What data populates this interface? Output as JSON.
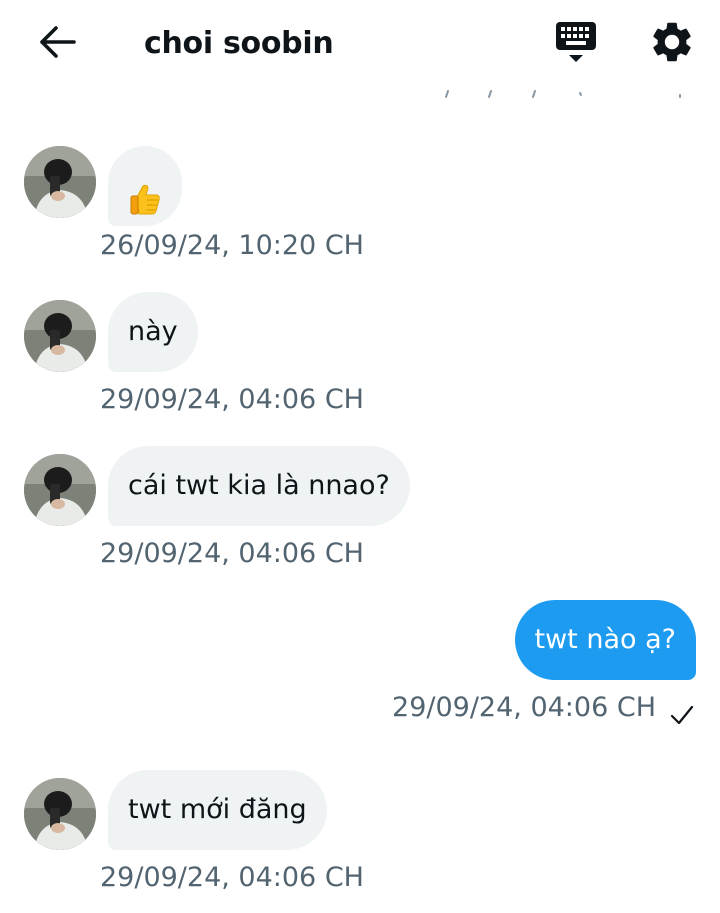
{
  "header": {
    "title": "choi soobin",
    "back_icon": "arrow-left-icon",
    "keyboard_icon": "keyboard-icon",
    "settings_icon": "gear-icon"
  },
  "colors": {
    "incoming_bubble": "#eff3f4",
    "outgoing_bubble": "#1d9bf0",
    "timestamp": "#536471"
  },
  "messages": [
    {
      "direction": "incoming",
      "content": "👍",
      "timestamp": "26/09/24, 10:20 CH"
    },
    {
      "direction": "incoming",
      "content": "này",
      "timestamp": "29/09/24, 04:06 CH"
    },
    {
      "direction": "incoming",
      "content": "cái twt kia là nnao?",
      "timestamp": "29/09/24, 04:06 CH"
    },
    {
      "direction": "outgoing",
      "content": "twt nào ạ?",
      "timestamp": "29/09/24, 04:06 CH",
      "status_icon": "checkmark-icon"
    },
    {
      "direction": "incoming",
      "content": "twt mới đăng",
      "timestamp": "29/09/24, 04:06 CH"
    }
  ]
}
